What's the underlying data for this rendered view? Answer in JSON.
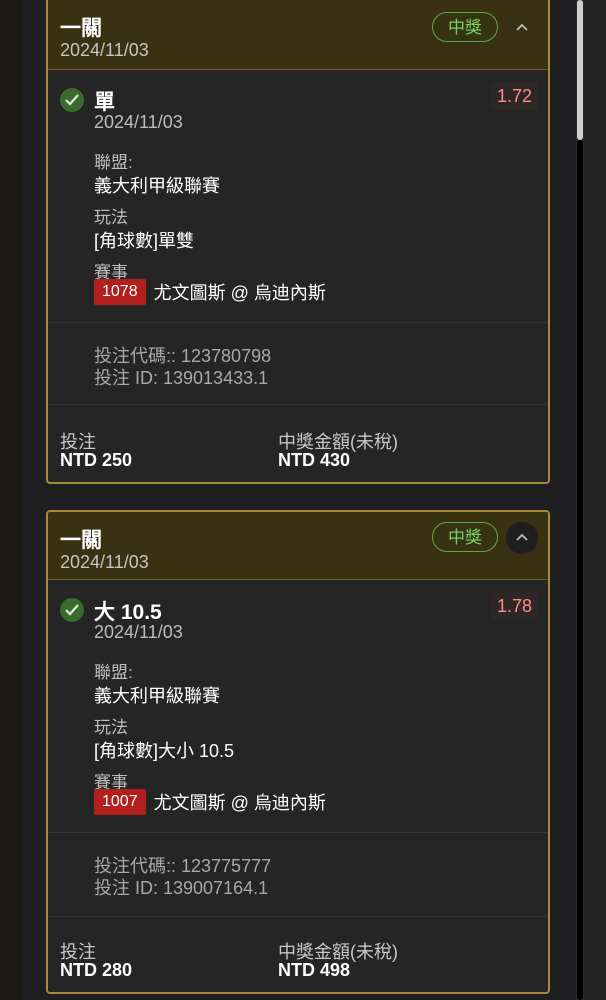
{
  "bets": [
    {
      "header_title": "一關",
      "header_date": "2024/11/03",
      "status": "中獎",
      "selection": "單",
      "selection_date": "2024/11/03",
      "odds": "1.72",
      "league_label": "聯盟:",
      "league": "義大利甲級聯賽",
      "market_label": "玩法",
      "market": "[角球數]單雙",
      "event_label": "賽事",
      "match_id": "1078",
      "match": "尤文圖斯 @ 烏迪內斯",
      "bet_code": "投注代碼:: 123780798",
      "bet_id": "投注 ID: 139013433.1",
      "stake_label": "投注",
      "stake": "NTD 250",
      "payout_label": "中獎金額(未稅)",
      "payout": "NTD 430"
    },
    {
      "header_title": "一關",
      "header_date": "2024/11/03",
      "status": "中獎",
      "selection": "大 10.5",
      "selection_date": "2024/11/03",
      "odds": "1.78",
      "league_label": "聯盟:",
      "league": "義大利甲級聯賽",
      "market_label": "玩法",
      "market": "[角球數]大小 10.5",
      "event_label": "賽事",
      "match_id": "1007",
      "match": "尤文圖斯 @ 烏迪內斯",
      "bet_code": "投注代碼:: 123775777",
      "bet_id": "投注 ID: 139007164.1",
      "stake_label": "投注",
      "stake": "NTD 280",
      "payout_label": "中獎金額(未稅)",
      "payout": "NTD 498"
    }
  ],
  "icons": {
    "check": "check-icon",
    "collapse": "chevron-up-icon"
  },
  "colors": {
    "card_border": "#a58a3c",
    "header_bg": "#3a3112",
    "win_green": "#7bd06a",
    "odds_red": "#ff8f82",
    "match_id_bg": "#b21f1f"
  }
}
